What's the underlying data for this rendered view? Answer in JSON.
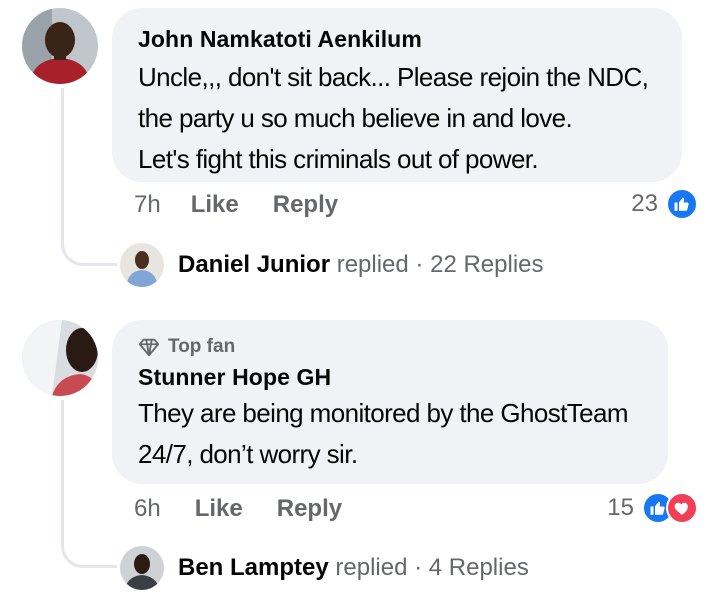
{
  "comments": [
    {
      "author": "John Namkatoti Aenkilum",
      "lines": [
        "Uncle,,, don't sit back... Please rejoin the NDC,",
        "the party u so much believe in and love.",
        "Let's fight this criminals out of power."
      ],
      "time": "7h",
      "like_label": "Like",
      "reply_label": "Reply",
      "reaction_count": "23",
      "reactions": [
        "like-icon"
      ],
      "reply_summary": {
        "name": "Daniel Junior",
        "replied_label": "replied",
        "dot": "·",
        "replies": "22 Replies"
      }
    },
    {
      "badge": "Top fan",
      "author": "Stunner Hope GH",
      "lines": [
        "They are being monitored by the GhostTeam",
        "24/7, don’t worry sir."
      ],
      "time": "6h",
      "like_label": "Like",
      "reply_label": "Reply",
      "reaction_count": "15",
      "reactions": [
        "like-icon",
        "love-icon"
      ],
      "reply_summary": {
        "name": "Ben Lamptey",
        "replied_label": "replied",
        "dot": "·",
        "replies": "4 Replies"
      }
    }
  ],
  "colors": {
    "bubble": "#f0f2f5",
    "secondary_text": "#65676b",
    "like_blue": "#1877f2",
    "love_red": "#f33e58"
  }
}
